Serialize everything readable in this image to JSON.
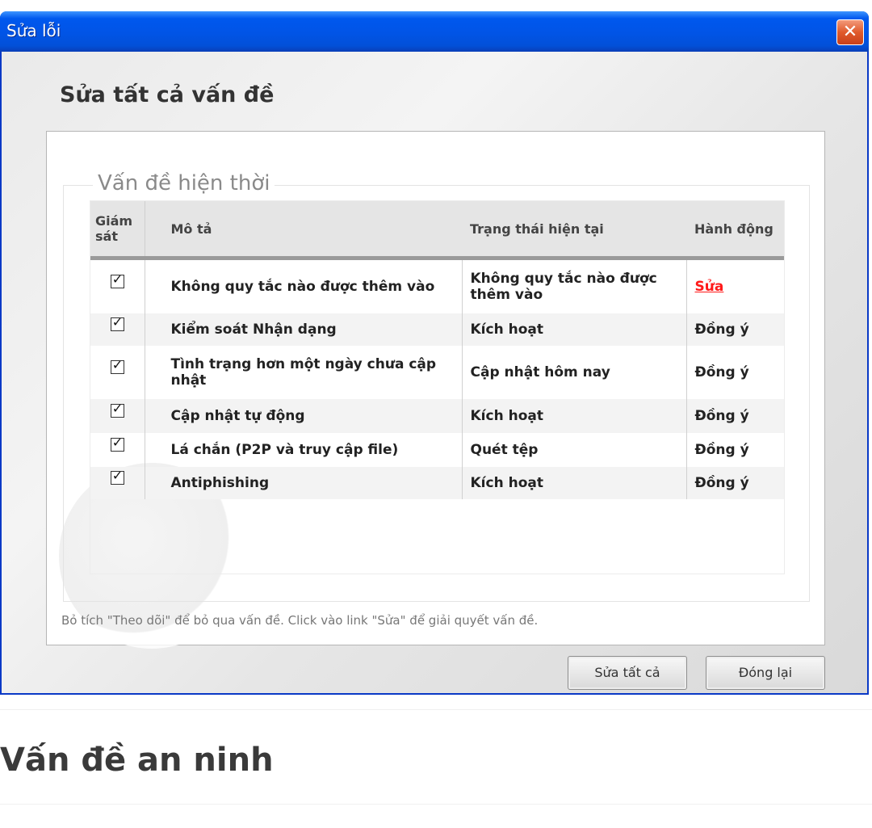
{
  "window": {
    "title": "Sửa lỗi",
    "close_glyph": "✕",
    "heading": "Sửa tất cả vấn đề"
  },
  "group": {
    "legend": "Vấn đề hiện thời"
  },
  "table": {
    "headers": {
      "monitor": "Giám sát",
      "description": "Mô tả",
      "status": "Trạng thái hiện tại",
      "action": "Hành động"
    },
    "rows": [
      {
        "checked": true,
        "description": "Không quy tắc nào được thêm vào",
        "status": "Không quy tắc nào được thêm vào",
        "action": "Sửa",
        "action_is_link": true
      },
      {
        "checked": true,
        "description": "Kiểm soát Nhận dạng",
        "status": "Kích hoạt",
        "action": "Đồng ý",
        "action_is_link": false
      },
      {
        "checked": true,
        "description": "Tình trạng hơn một ngày chưa cập nhật",
        "status": "Cập nhật hôm nay",
        "action": "Đồng ý",
        "action_is_link": false
      },
      {
        "checked": true,
        "description": "Cập nhật tự động",
        "status": "Kích hoạt",
        "action": "Đồng ý",
        "action_is_link": false
      },
      {
        "checked": true,
        "description": "Lá chắn (P2P và truy cập file)",
        "status": "Quét tệp",
        "action": "Đồng ý",
        "action_is_link": false
      },
      {
        "checked": true,
        "description": "Antiphishing",
        "status": "Kích hoạt",
        "action": "Đồng ý",
        "action_is_link": false
      }
    ]
  },
  "footer": {
    "hint": "Bỏ tích \"Theo dõi\" để bỏ qua vấn đề. Click vào link \"Sửa\" để giải quyết vấn đề.",
    "fix_all_button": "Sửa tất cả",
    "close_button": "Đóng lại"
  },
  "page": {
    "section_heading": "Vấn đề an ninh"
  },
  "colors": {
    "titlebar": "#0154e6",
    "link": "#ff1a1a",
    "close_button": "#e05a2b"
  }
}
